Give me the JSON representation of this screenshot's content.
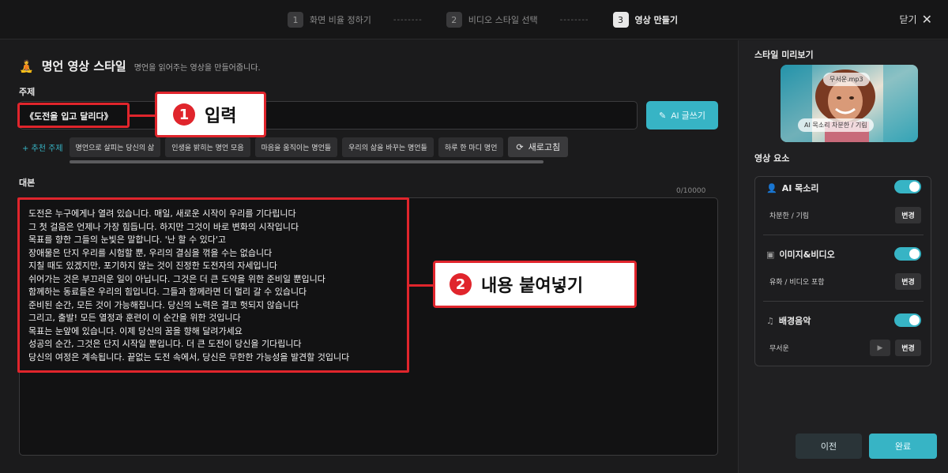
{
  "header": {
    "steps": [
      {
        "num": "1",
        "label": "화면 비율 정하기"
      },
      {
        "num": "2",
        "label": "비디오 스타일 선택"
      },
      {
        "num": "3",
        "label": "영상 만들기"
      }
    ],
    "dash": "--------",
    "close_label": "닫기",
    "close_icon": "close-icon"
  },
  "main": {
    "title": "명언 영상 스타일",
    "subtitle": "명언을 읽어주는 영상을 만들어줍니다.",
    "topic_label": "주제",
    "topic_value": "《도전을 입고 달리다》",
    "ai_write_label": "AI 글쓰기",
    "recommend_label": "+ 추천 주제",
    "chips": [
      "명언으로 살피는 당신의 삶",
      "인생을 밝히는 명언 모음",
      "마음을 움직이는 명언들",
      "우리의 삶을 바꾸는 명언들",
      "하루 한 마디 명언"
    ],
    "refresh_label": "새로고침",
    "script_label": "대본",
    "char_count": "0/10000",
    "script_lines": [
      "도전은 누구에게나 열려 있습니다. 매일, 새로운 시작이 우리를 기다립니다",
      "그 첫 걸음은 언제나 가장 힘듭니다. 하지만 그것이 바로 변화의 시작입니다",
      "목표를 향한 그들의 눈빛은 말합니다. '난 할 수 있다'고",
      "장애물은 단지 우리를 시험할 뿐, 우리의 결심을 꺾을 수는 없습니다",
      "지칠 때도 있겠지만, 포기하지 않는 것이 진정한 도전자의 자세입니다",
      "쉬어가는 것은 부끄러운 일이 아닙니다. 그것은 더 큰 도약을 위한 준비일 뿐입니다",
      "함께하는 동료들은 우리의 힘입니다. 그들과 함께라면 더 멀리 갈 수 있습니다",
      "준비된 순간, 모든 것이 가능해집니다. 당신의 노력은 결코 헛되지 않습니다",
      "그리고, 출발! 모든 열정과 훈련이 이 순간을 위한 것입니다",
      "목표는 눈앞에 있습니다. 이제 당신의 꿈을 향해 달려가세요",
      "성공의 순간, 그것은 단지 시작일 뿐입니다. 더 큰 도전이 당신을 기다립니다",
      "당신의 여정은 계속됩니다. 끝없는 도전 속에서, 당신은 무한한 가능성을 발견할 것입니다"
    ]
  },
  "annotations": {
    "callout1": {
      "num": "1",
      "text": "입력"
    },
    "callout2": {
      "num": "2",
      "text": "내용 붙여넣기"
    },
    "color": "#e0252c"
  },
  "side": {
    "preview_title": "스타일 미리보기",
    "preview_mp3": "무서운.mp3",
    "preview_voice": "AI 목소리   차분한 / 기림",
    "elements_title": "영상 요소",
    "elements": [
      {
        "label": "AI 목소리",
        "icon": "person-voice-icon",
        "sub": "차분한 / 기림",
        "on": true
      },
      {
        "label": "이미지&비디오",
        "icon": "image-video-icon",
        "sub": "유화 / 비디오 포함",
        "on": true
      },
      {
        "label": "배경음악",
        "icon": "music-note-icon",
        "sub": "무서운",
        "on": true
      }
    ],
    "change_label": "변경",
    "prev_label": "이전",
    "done_label": "완료"
  },
  "colors": {
    "accent": "#37b4c5",
    "background": "#1b1b1c",
    "panel": "#202022"
  }
}
